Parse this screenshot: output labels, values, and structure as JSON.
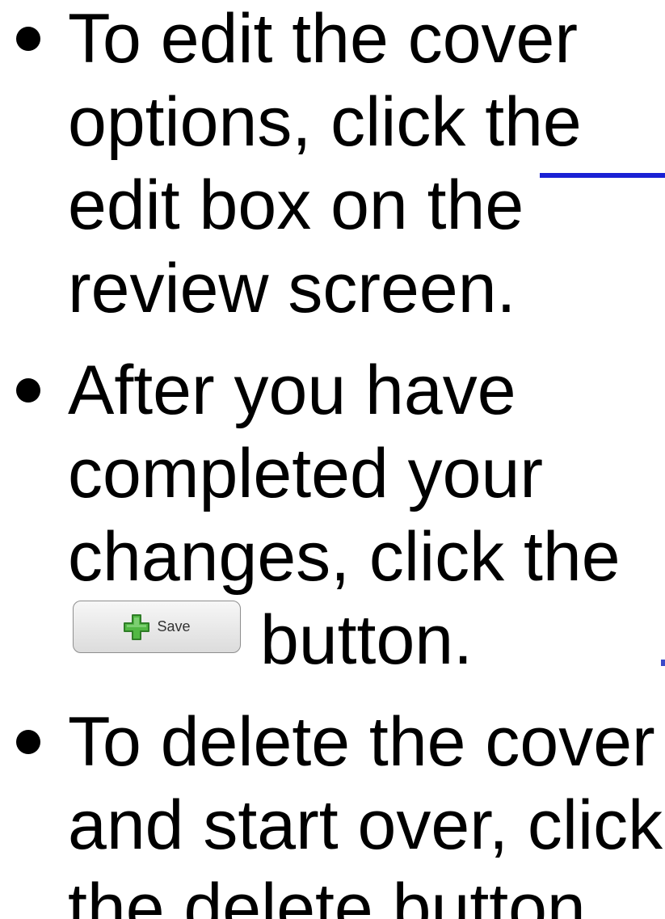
{
  "bullets": [
    {
      "lines": [
        "To edit the cover",
        "options, click the",
        "edit box on the",
        "review screen."
      ]
    },
    {
      "lines": [
        "After you have",
        "completed your",
        "changes, click the",
        "button."
      ],
      "inline_button": {
        "label": "Save",
        "icon": "green-plus-icon"
      }
    },
    {
      "lines": [
        "To delete the cover",
        "and start over, click",
        "the delete button."
      ]
    }
  ],
  "colors": {
    "accent_blue": "#1a21d4",
    "plus_green": "#52b844"
  }
}
